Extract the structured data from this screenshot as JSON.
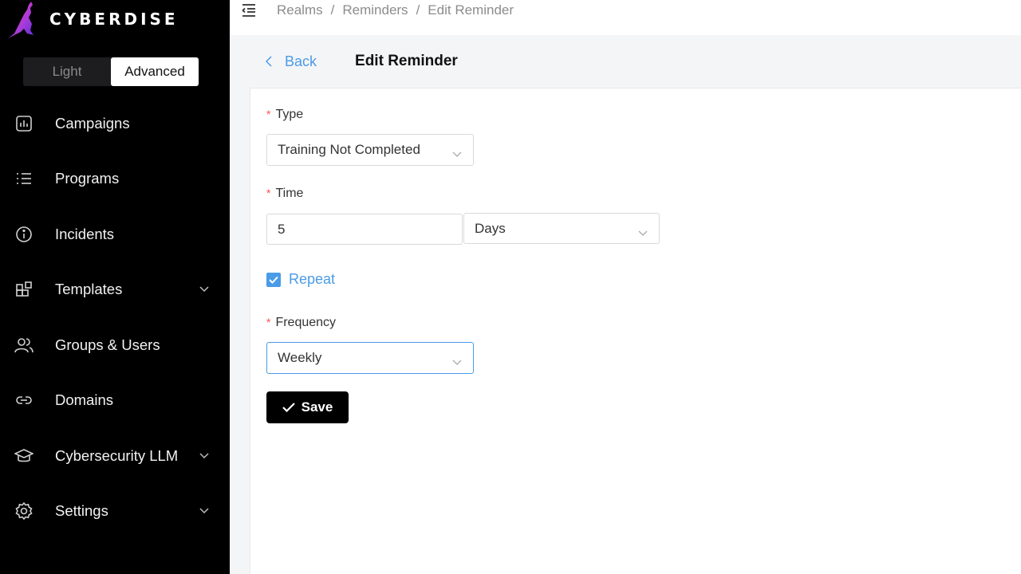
{
  "app": {
    "brand": "CYBERDISE"
  },
  "mode_toggle": {
    "options": [
      "Light",
      "Advanced"
    ],
    "selected": "Advanced"
  },
  "sidebar": {
    "items": [
      {
        "label": "Campaigns",
        "icon": "bar-chart-icon",
        "has_submenu": false
      },
      {
        "label": "Programs",
        "icon": "list-icon",
        "has_submenu": false
      },
      {
        "label": "Incidents",
        "icon": "info-circle-icon",
        "has_submenu": false
      },
      {
        "label": "Templates",
        "icon": "blocks-icon",
        "has_submenu": true
      },
      {
        "label": "Groups & Users",
        "icon": "users-icon",
        "has_submenu": false
      },
      {
        "label": "Domains",
        "icon": "link-icon",
        "has_submenu": false
      },
      {
        "label": "Cybersecurity LLM",
        "icon": "graduation-cap-icon",
        "has_submenu": true
      },
      {
        "label": "Settings",
        "icon": "gear-icon",
        "has_submenu": true
      }
    ]
  },
  "breadcrumb": {
    "items": [
      "Realms",
      "Reminders",
      "Edit Reminder"
    ],
    "separator": "/"
  },
  "header": {
    "back_label": "Back",
    "title": "Edit Reminder"
  },
  "form": {
    "type": {
      "label": "Type",
      "value": "Training Not Completed",
      "required": true
    },
    "time": {
      "label": "Time",
      "amount": "5",
      "unit": "Days",
      "required": true
    },
    "repeat": {
      "label": "Repeat",
      "checked": true
    },
    "frequency": {
      "label": "Frequency",
      "value": "Weekly",
      "required": true
    },
    "save_label": "Save"
  },
  "colors": {
    "accent": "#4a9be8",
    "sidebar_bg": "#000000",
    "required": "#ff4d4f",
    "button_bg": "#000000"
  }
}
